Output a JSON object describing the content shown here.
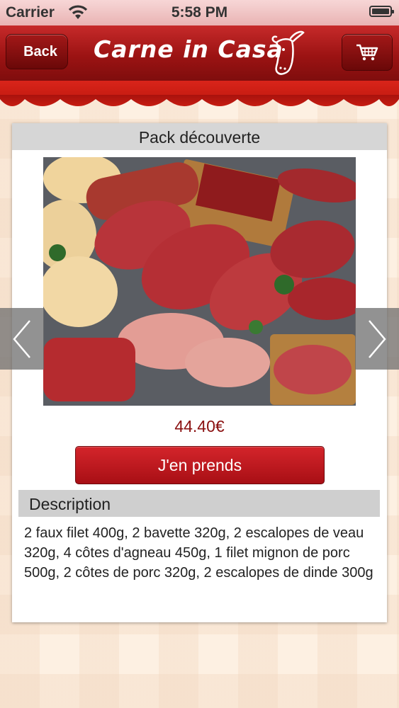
{
  "status_bar": {
    "carrier": "Carrier",
    "time": "5:58 PM"
  },
  "nav": {
    "back_label": "Back",
    "brand": "Carne in Casa",
    "cart_icon": "cart-icon",
    "colors": {
      "bar_top": "#c72a2a",
      "bar_bottom": "#7f0d0d"
    }
  },
  "product": {
    "title": "Pack découverte",
    "image_icon": "meat-platter-image",
    "price": "44.40€",
    "buy_label": "J'en prends",
    "description_header": "Description",
    "description": "2 faux filet  400g, 2 bavette  320g, 2 escalopes de veau  320g, 4 côtes d'agneau  450g, 1 filet mignon de porc  500g, 2 côtes de porc  320g, 2 escalopes de dinde  300g"
  },
  "carousel": {
    "prev_icon": "chevron-left-icon",
    "next_icon": "chevron-right-icon"
  },
  "colors": {
    "accent": "#b4161d",
    "price": "#8a1010",
    "header_gray": "#d6d6d6"
  }
}
